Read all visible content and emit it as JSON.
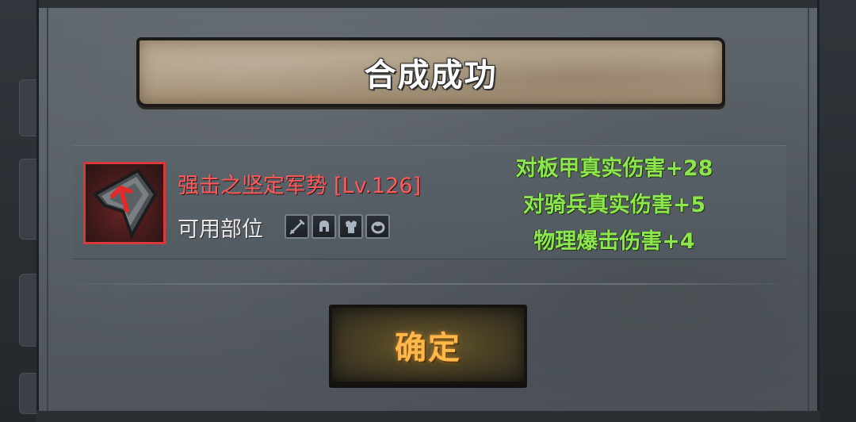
{
  "dialog": {
    "title": "合成成功",
    "item": {
      "name": "强击之坚定军势",
      "level": "[Lv.126]",
      "icon": "red-arrow-shield-fragment-icon",
      "rarity_color": "#d83a3a"
    },
    "parts": {
      "label": "可用部位",
      "slots": [
        {
          "icon": "sword-icon"
        },
        {
          "icon": "helmet-icon"
        },
        {
          "icon": "armor-icon"
        },
        {
          "icon": "ring-icon"
        }
      ]
    },
    "stats": [
      "对板甲真实伤害+28",
      "对骑兵真实伤害+5",
      "物理爆击伤害+4"
    ],
    "confirm_label": "确定"
  },
  "colors": {
    "stat_green": "#8ee64e",
    "name_red": "#ff5a5a",
    "button_text": "#ffb64a"
  }
}
